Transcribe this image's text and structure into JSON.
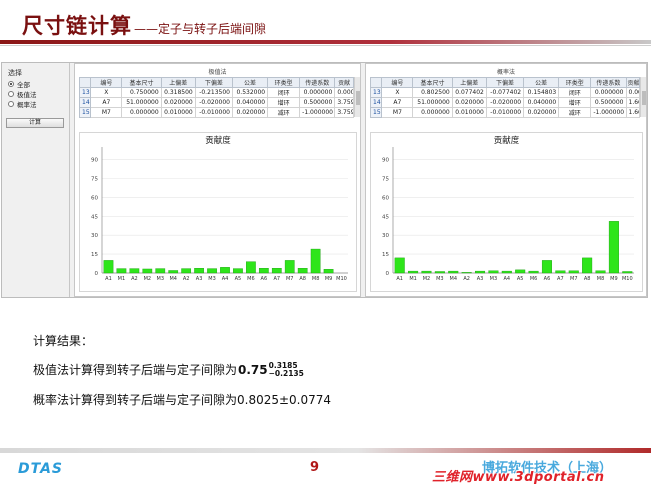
{
  "slide": {
    "title": "尺寸链计算",
    "dash": "——",
    "subtitle": "定子与转子后端间隙",
    "page_number": "9",
    "logo": "DTAS",
    "company": "博拓软件技术（上海）",
    "watermark": "三维网www.3dportal.cn"
  },
  "app": {
    "select_group_title": "选择",
    "radio_options": [
      {
        "label": "全部",
        "checked": true
      },
      {
        "label": "极值法",
        "checked": false
      },
      {
        "label": "概率法",
        "checked": false
      }
    ],
    "calc_button": "计算",
    "extreme_section": {
      "caption": "极值法",
      "columns": [
        "编号",
        "基本尺寸",
        "上偏差",
        "下偏差",
        "公差",
        "环类型",
        "传递系数",
        "贡献"
      ],
      "rows": [
        {
          "idx": "13",
          "cells": [
            "X",
            "0.750000",
            "0.318500",
            "-0.213500",
            "0.532000",
            "闭环",
            "0.000000",
            "0.000"
          ]
        },
        {
          "idx": "14",
          "cells": [
            "A7",
            "51.000000",
            "0.020000",
            "-0.020000",
            "0.040000",
            "增环",
            "0.500000",
            "3.759"
          ]
        },
        {
          "idx": "15",
          "cells": [
            "M7",
            "0.000000",
            "0.010000",
            "-0.010000",
            "0.020000",
            "减环",
            "-1.000000",
            "3.759"
          ]
        }
      ]
    },
    "probability_section": {
      "caption": "概率法",
      "columns": [
        "编号",
        "基本尺寸",
        "上偏差",
        "下偏差",
        "公差",
        "环类型",
        "传递系数",
        "贡献"
      ],
      "rows": [
        {
          "idx": "13",
          "cells": [
            "X",
            "0.802500",
            "0.077402",
            "-0.077402",
            "0.154803",
            "闭环",
            "0.000000",
            "0.000"
          ]
        },
        {
          "idx": "14",
          "cells": [
            "A7",
            "51.000000",
            "0.020000",
            "-0.020000",
            "0.040000",
            "增环",
            "0.500000",
            "1.669"
          ]
        },
        {
          "idx": "15",
          "cells": [
            "M7",
            "0.000000",
            "0.010000",
            "-0.010000",
            "0.020000",
            "减环",
            "-1.000000",
            "1.669"
          ]
        }
      ]
    }
  },
  "results": {
    "header": "计算结果：",
    "extreme_text": "极值法计算得到转子后端与定子间隙为",
    "extreme_value": "0.75",
    "extreme_upper": "0.3185",
    "extreme_lower": "−0.2135",
    "probability_text": "概率法计算得到转子后端与定子间隙为0.8025±0.0774"
  },
  "chart_data": [
    {
      "type": "bar",
      "title": "贡献度",
      "categories": [
        "A1",
        "M1",
        "A2",
        "M2",
        "M3",
        "M4",
        "A2",
        "A3",
        "M3",
        "A4",
        "A5",
        "M6",
        "A6",
        "A7",
        "M7",
        "A8",
        "M8",
        "M9",
        "M10"
      ],
      "values": [
        10,
        3.5,
        3.5,
        3.2,
        3.5,
        2,
        3.5,
        3.8,
        3.5,
        4.5,
        3.5,
        9,
        3.8,
        3.8,
        10,
        3.8,
        19,
        3
      ],
      "yticks": [
        0,
        15,
        30,
        45,
        60,
        75,
        90
      ],
      "ylim": [
        0,
        100
      ],
      "bar_color": "#2ee51a"
    },
    {
      "type": "bar",
      "title": "贡献度",
      "categories": [
        "A1",
        "M1",
        "M2",
        "M3",
        "M4",
        "A2",
        "A3",
        "M3",
        "A4",
        "A5",
        "M6",
        "A6",
        "A7",
        "M7",
        "A8",
        "M8",
        "M9",
        "M10"
      ],
      "values": [
        12,
        1.5,
        1.5,
        1.2,
        1.5,
        0.5,
        1.5,
        1.8,
        1.5,
        2.5,
        1.5,
        10,
        1.8,
        1.8,
        12,
        1.8,
        41,
        1.2
      ],
      "yticks": [
        0,
        15,
        30,
        45,
        60,
        75,
        90
      ],
      "ylim": [
        0,
        100
      ],
      "bar_color": "#2ee51a"
    }
  ]
}
